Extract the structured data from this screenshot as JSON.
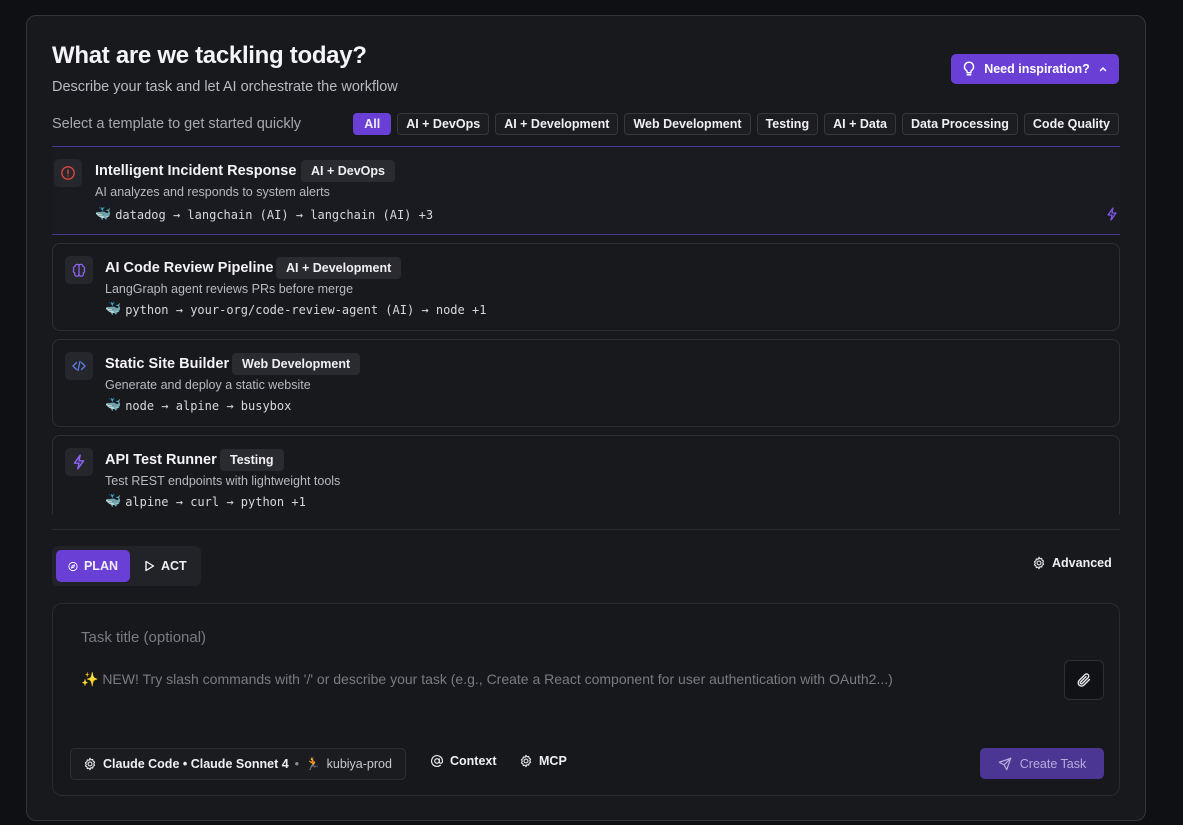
{
  "header": {
    "title": "What are we tackling today?",
    "subtitle": "Describe your task and let AI orchestrate the workflow",
    "inspiration_label": "Need inspiration?"
  },
  "templates": {
    "hint": "Select a template to get started quickly",
    "filters": [
      "All",
      "AI + DevOps",
      "AI + Development",
      "Web Development",
      "Testing",
      "AI + Data",
      "Data Processing",
      "Code Quality"
    ],
    "active_filter": "All",
    "items": [
      {
        "title": "Intelligent Incident Response",
        "tag": "AI + DevOps",
        "description": "AI analyzes and responds to system alerts",
        "flow": "datadog → langchain (AI) → langchain (AI) +3",
        "icon": "alert-circle-icon"
      },
      {
        "title": "AI Code Review Pipeline",
        "tag": "AI + Development",
        "description": "LangGraph agent reviews PRs before merge",
        "flow": "python → your-org/code-review-agent (AI) → node +1",
        "icon": "brain-icon"
      },
      {
        "title": "Static Site Builder",
        "tag": "Web Development",
        "description": "Generate and deploy a static website",
        "flow": "node → alpine → busybox",
        "icon": "code-icon"
      },
      {
        "title": "API Test Runner",
        "tag": "Testing",
        "description": "Test REST endpoints with lightweight tools",
        "flow": "alpine → curl → python +1",
        "icon": "bolt-icon"
      }
    ]
  },
  "mode": {
    "plan_label": "PLAN",
    "act_label": "ACT",
    "active": "PLAN",
    "advanced_label": "Advanced"
  },
  "composer": {
    "title_placeholder": "Task title (optional)",
    "task_placeholder": "✨ NEW! Try slash commands with '/' or describe your task (e.g., Create a React component for user authentication with OAuth2...)",
    "model_label": "Claude Code • Claude Sonnet 4",
    "env_separator": "•",
    "env_label": "kubiya-prod",
    "env_icon": "🏃",
    "context_label": "Context",
    "mcp_label": "MCP",
    "create_label": "Create Task"
  },
  "colors": {
    "accent": "#6a3fd6",
    "background": "#0f1013",
    "panel": "#18191d",
    "alert": "#d9473f"
  }
}
